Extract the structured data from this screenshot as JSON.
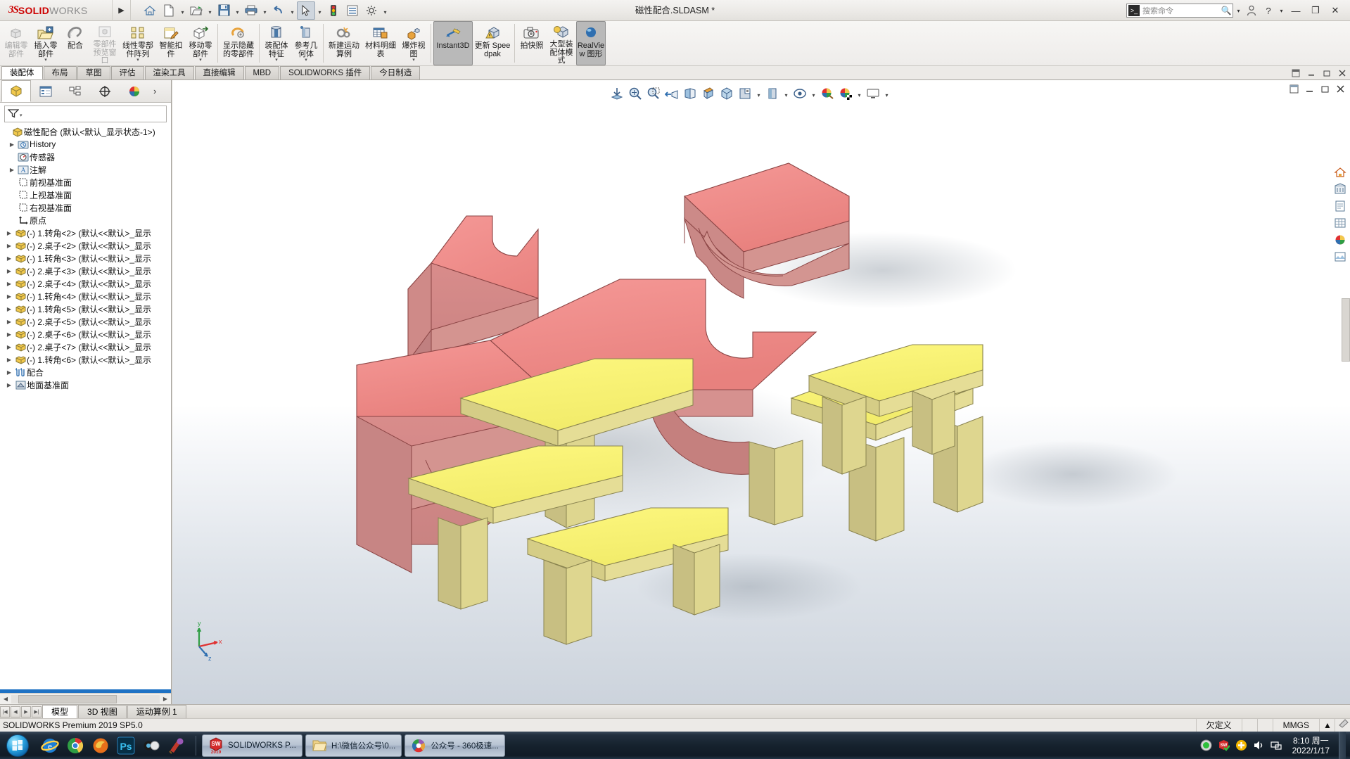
{
  "titlebar": {
    "logo_ds": "3S",
    "logo_solid": "SOLID",
    "logo_works": "WORKS",
    "expand_arrow": "▶",
    "document_title": "磁性配合.SLDASM *",
    "quick_access": [
      {
        "name": "home-icon",
        "glyph": "⌂"
      },
      {
        "name": "new-document-icon",
        "glyph": "🗋"
      },
      {
        "name": "open-document-icon",
        "glyph": "📂"
      },
      {
        "name": "save-icon",
        "glyph": "💾"
      },
      {
        "name": "print-icon",
        "glyph": "🖶"
      },
      {
        "name": "undo-icon",
        "glyph": "↰"
      },
      {
        "name": "select-icon",
        "glyph": "➤"
      },
      {
        "name": "rebuild-icon",
        "glyph": "🚦"
      },
      {
        "name": "display-manager-icon",
        "glyph": "▤"
      },
      {
        "name": "options-icon",
        "glyph": "⚙"
      }
    ],
    "search_placeholder": "搜索命令",
    "search_value": "",
    "profile_icon": "👤",
    "help_icon": "?",
    "minimize": "—",
    "restore": "❐",
    "close": "✕"
  },
  "ribbon": {
    "groups": [
      {
        "buttons": [
          {
            "label": "编辑零部件",
            "disabled": true,
            "dropdown": false,
            "icon": "edit-component-icon"
          },
          {
            "label": "插入零部件",
            "disabled": false,
            "dropdown": true,
            "icon": "insert-component-icon"
          },
          {
            "label": "配合",
            "disabled": false,
            "dropdown": false,
            "icon": "mate-icon"
          },
          {
            "label": "零部件预览窗口",
            "disabled": true,
            "dropdown": false,
            "icon": "component-preview-icon"
          },
          {
            "label": "线性零部件阵列",
            "disabled": false,
            "dropdown": true,
            "icon": "linear-pattern-icon"
          },
          {
            "label": "智能扣件",
            "disabled": false,
            "dropdown": false,
            "icon": "smart-fasteners-icon"
          },
          {
            "label": "移动零部件",
            "disabled": false,
            "dropdown": true,
            "icon": "move-component-icon"
          }
        ]
      },
      {
        "buttons": [
          {
            "label": "显示隐藏的零部件",
            "disabled": false,
            "dropdown": false,
            "icon": "show-hidden-components-icon"
          }
        ]
      },
      {
        "buttons": [
          {
            "label": "装配体特征",
            "disabled": false,
            "dropdown": true,
            "icon": "assembly-features-icon"
          },
          {
            "label": "参考几何体",
            "disabled": false,
            "dropdown": true,
            "icon": "reference-geometry-icon"
          }
        ]
      },
      {
        "buttons": [
          {
            "label": "新建运动算例",
            "disabled": false,
            "dropdown": false,
            "icon": "new-motion-study-icon"
          },
          {
            "label": "材料明细表",
            "disabled": false,
            "dropdown": false,
            "icon": "bill-of-materials-icon"
          },
          {
            "label": "爆炸视图",
            "disabled": false,
            "dropdown": true,
            "icon": "exploded-view-icon"
          }
        ]
      },
      {
        "buttons": [
          {
            "label": "Instant3D",
            "disabled": false,
            "dropdown": false,
            "selected": true,
            "icon": "instant3d-icon"
          },
          {
            "label": "更新 Speedpak",
            "disabled": false,
            "dropdown": false,
            "icon": "update-speedpak-icon"
          }
        ]
      },
      {
        "buttons": [
          {
            "label": "拍快照",
            "disabled": false,
            "dropdown": false,
            "icon": "snapshot-icon"
          },
          {
            "label": "大型装配体模式",
            "disabled": false,
            "dropdown": false,
            "icon": "large-assembly-mode-icon"
          },
          {
            "label": "RealView 图形",
            "disabled": false,
            "dropdown": false,
            "selected": true,
            "icon": "realview-graphics-icon"
          }
        ]
      }
    ]
  },
  "command_tabs": {
    "tabs": [
      {
        "label": "装配体",
        "active": true
      },
      {
        "label": "布局",
        "active": false
      },
      {
        "label": "草图",
        "active": false
      },
      {
        "label": "评估",
        "active": false
      },
      {
        "label": "渲染工具",
        "active": false
      },
      {
        "label": "直接编辑",
        "active": false
      },
      {
        "label": "MBD",
        "active": false
      },
      {
        "label": "SOLIDWORKS 插件",
        "active": false
      },
      {
        "label": "今日制造",
        "active": false
      }
    ],
    "right_controls": [
      "pin-icon",
      "minimize-icon",
      "restore-icon",
      "close-icon"
    ]
  },
  "left_panel": {
    "tabs": [
      {
        "name": "feature-manager-tab",
        "icon": "feature-tree-icon",
        "active": true
      },
      {
        "name": "property-manager-tab",
        "icon": "property-list-icon",
        "active": false
      },
      {
        "name": "configuration-manager-tab",
        "icon": "configuration-icon",
        "active": false
      },
      {
        "name": "dimxpert-manager-tab",
        "icon": "dimxpert-icon",
        "active": false
      },
      {
        "name": "display-manager-tab",
        "icon": "appearance-sphere-icon",
        "active": false
      }
    ],
    "more_arrow": "›",
    "filter_placeholder": "",
    "tree": [
      {
        "label": "磁性配合  (默认<默认_显示状态-1>)",
        "icon": "assembly-icon",
        "expandable": false,
        "indent": 0,
        "root": true
      },
      {
        "label": "History",
        "icon": "history-icon",
        "expandable": true,
        "indent": 1
      },
      {
        "label": "传感器",
        "icon": "sensors-icon",
        "expandable": false,
        "indent": 1
      },
      {
        "label": "注解",
        "icon": "annotations-icon",
        "expandable": true,
        "indent": 1
      },
      {
        "label": "前视基准面",
        "icon": "plane-icon",
        "expandable": false,
        "indent": 1
      },
      {
        "label": "上视基准面",
        "icon": "plane-icon",
        "expandable": false,
        "indent": 1
      },
      {
        "label": "右视基准面",
        "icon": "plane-icon",
        "expandable": false,
        "indent": 1
      },
      {
        "label": "原点",
        "icon": "origin-icon",
        "expandable": false,
        "indent": 1
      },
      {
        "label": "(-) 1.转角<2>  (默认<<默认>_显示",
        "icon": "part-icon",
        "expandable": true,
        "indent": 0
      },
      {
        "label": "(-) 2.桌子<2>  (默认<<默认>_显示",
        "icon": "part-icon",
        "expandable": true,
        "indent": 0
      },
      {
        "label": "(-) 1.转角<3>  (默认<<默认>_显示",
        "icon": "part-icon",
        "expandable": true,
        "indent": 0
      },
      {
        "label": "(-) 2.桌子<3>  (默认<<默认>_显示",
        "icon": "part-icon",
        "expandable": true,
        "indent": 0
      },
      {
        "label": "(-) 2.桌子<4>  (默认<<默认>_显示",
        "icon": "part-icon",
        "expandable": true,
        "indent": 0
      },
      {
        "label": "(-) 1.转角<4>  (默认<<默认>_显示",
        "icon": "part-icon",
        "expandable": true,
        "indent": 0
      },
      {
        "label": "(-) 1.转角<5>  (默认<<默认>_显示",
        "icon": "part-icon",
        "expandable": true,
        "indent": 0
      },
      {
        "label": "(-) 2.桌子<5>  (默认<<默认>_显示",
        "icon": "part-icon",
        "expandable": true,
        "indent": 0
      },
      {
        "label": "(-) 2.桌子<6>  (默认<<默认>_显示",
        "icon": "part-icon",
        "expandable": true,
        "indent": 0
      },
      {
        "label": "(-) 2.桌子<7>  (默认<<默认>_显示",
        "icon": "part-icon",
        "expandable": true,
        "indent": 0
      },
      {
        "label": "(-) 1.转角<6>  (默认<<默认>_显示",
        "icon": "part-icon",
        "expandable": true,
        "indent": 0
      },
      {
        "label": "配合",
        "icon": "mates-folder-icon",
        "expandable": true,
        "indent": 0
      },
      {
        "label": "地面基准面",
        "icon": "ground-plane-icon",
        "expandable": true,
        "indent": 0
      }
    ]
  },
  "graphics": {
    "view_toolbar": [
      {
        "name": "zoom-to-fit-icon",
        "glyph": "⤓"
      },
      {
        "name": "zoom-to-area-icon",
        "glyph": "🔍"
      },
      {
        "name": "zoom-window-icon",
        "glyph": "🔎"
      },
      {
        "name": "previous-view-icon",
        "glyph": "⇦"
      },
      {
        "name": "section-view-icon",
        "glyph": "◧"
      },
      {
        "name": "view-orientation-icon",
        "glyph": "◪"
      },
      {
        "name": "display-style-icon",
        "glyph": "⬡"
      },
      {
        "name": "hide-show-items-icon",
        "glyph": "▣"
      },
      {
        "name": "edit-appearance-icon",
        "glyph": "▥"
      },
      {
        "name": "apply-scene-icon",
        "glyph": "◉"
      },
      {
        "name": "view-settings-icon",
        "glyph": "🎨"
      },
      {
        "name": "scene-icon",
        "glyph": "🌐"
      },
      {
        "name": "viewport-icon",
        "glyph": "🖵"
      }
    ],
    "window_buttons": [
      "pin-icon",
      "minimize-icon",
      "restore-icon",
      "close-icon"
    ],
    "right_toolbar": [
      {
        "name": "home-view-icon",
        "glyph": "🏠"
      },
      {
        "name": "display-pane-icon",
        "glyph": "🏛"
      },
      {
        "name": "drawing-icon",
        "glyph": "🗎"
      },
      {
        "name": "section-properties-icon",
        "glyph": "▦"
      },
      {
        "name": "appearances-icon",
        "glyph": "🎨"
      },
      {
        "name": "decals-icon",
        "glyph": "▤"
      }
    ],
    "triad_labels": {
      "x": "x",
      "y": "y",
      "z": "z"
    }
  },
  "bottom_tabs": {
    "nav": [
      "|◀",
      "◀",
      "▶",
      "▶|"
    ],
    "tabs": [
      {
        "label": "模型",
        "active": true
      },
      {
        "label": "3D 视图",
        "active": false
      },
      {
        "label": "运动算例 1",
        "active": false
      }
    ]
  },
  "status_bar": {
    "left_text": "SOLIDWORKS Premium 2019 SP5.0",
    "state": "欠定义",
    "units": "MMGS",
    "units_caret": "▲",
    "edit_icon": "✎"
  },
  "taskbar": {
    "start": "start-orb",
    "quick_launch": [
      {
        "name": "ie-browser-icon"
      },
      {
        "name": "chrome-browser-icon"
      },
      {
        "name": "firefox-browser-icon"
      },
      {
        "name": "photoshop-icon",
        "label": "Ps"
      },
      {
        "name": "solidworks-composer-icon"
      },
      {
        "name": "paint-icon"
      }
    ],
    "tasks": [
      {
        "label": "SOLIDWORKS P...",
        "icon": "solidworks-app-icon",
        "active": true
      },
      {
        "label": "H:\\微信公众号\\0...",
        "icon": "folder-icon",
        "active": false
      },
      {
        "label": "公众号 - 360极速...",
        "icon": "360-browser-icon",
        "active": false
      }
    ],
    "tray": [
      {
        "name": "tray-record-icon"
      },
      {
        "name": "tray-solidworks-icon"
      },
      {
        "name": "tray-update-icon"
      },
      {
        "name": "tray-volume-icon"
      },
      {
        "name": "tray-network-icon"
      }
    ],
    "clock_time": "8:10 周一",
    "clock_date": "2022/1/17"
  }
}
